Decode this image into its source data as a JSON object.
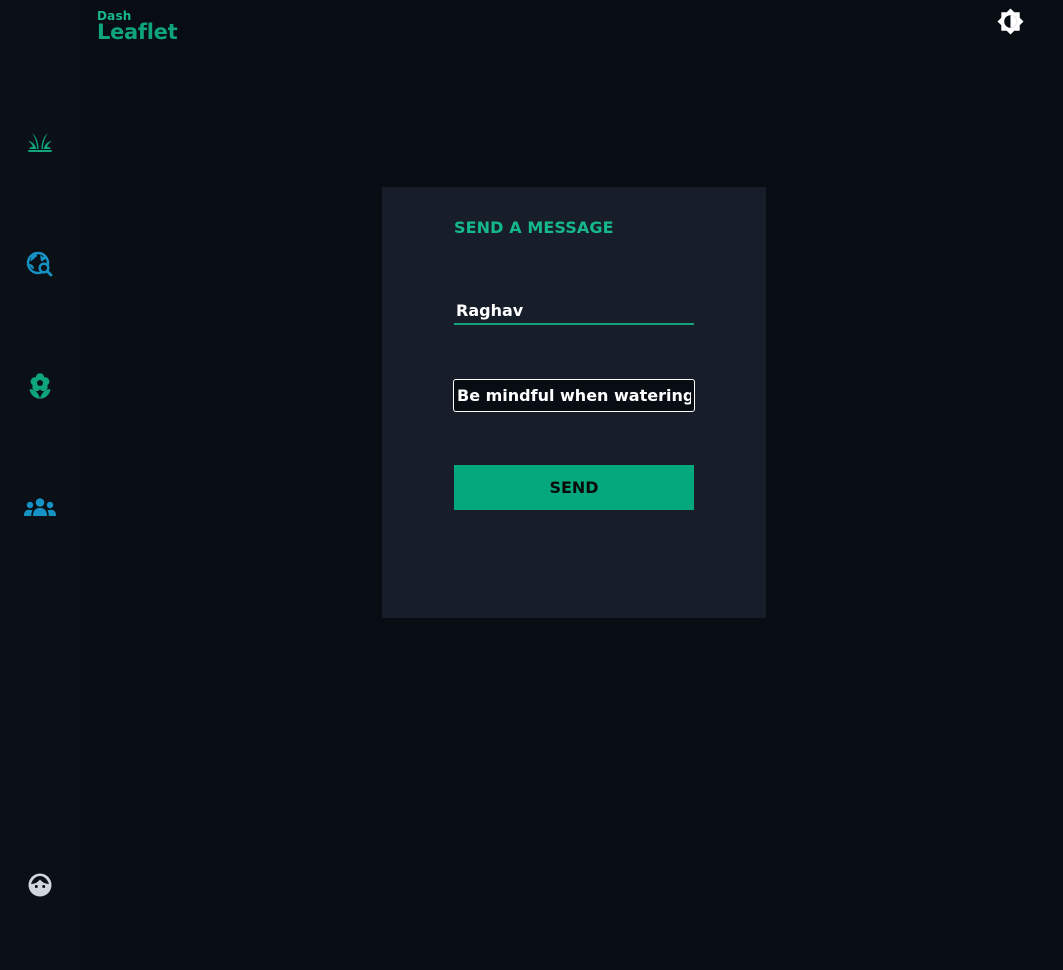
{
  "brand": {
    "small": "Dash",
    "large": "Leaflet"
  },
  "sidebar": {
    "items": [
      {
        "icon": "grass-icon",
        "color": "#0fa57a"
      },
      {
        "icon": "travel-explore-icon",
        "color": "#1692c4"
      },
      {
        "icon": "local-florist-icon",
        "color": "#0fa57a"
      },
      {
        "icon": "groups-icon",
        "color": "#1692c4"
      }
    ],
    "footer_icon": {
      "icon": "face-icon",
      "color": "#d0d6dc"
    }
  },
  "header": {
    "theme_toggle_icon": "brightness-icon"
  },
  "form": {
    "title": "SEND A MESSAGE",
    "name_value": "Raghav",
    "message_value": "Be mindful when watering t",
    "send_label": "SEND"
  },
  "colors": {
    "accent": "#0fa57a",
    "button": "#05a87d",
    "card_bg": "#181e29",
    "page_bg": "#080c13",
    "sidebar_bg": "#0b1017",
    "secondary_icon": "#1692c4"
  }
}
